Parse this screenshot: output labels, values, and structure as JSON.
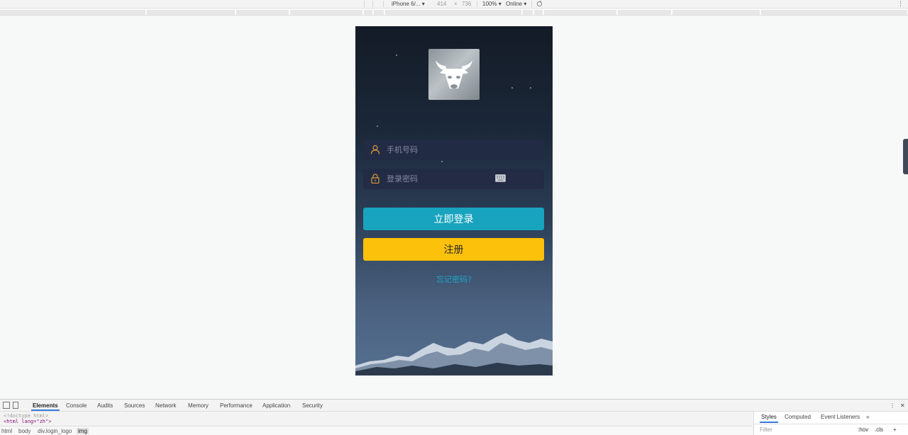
{
  "device_toolbar": {
    "device": "iPhone 6/...",
    "device_caret": "▾",
    "width": "414",
    "times": "×",
    "height": "736",
    "zoom": "100%",
    "zoom_caret": "▾",
    "network": "Online",
    "network_caret": "▾",
    "more": "⋮"
  },
  "login": {
    "phone_placeholder": "手机号码",
    "password_placeholder": "登录密码",
    "login_button": "立即登录",
    "register_button": "注册",
    "forgot_link": "忘记密码?"
  },
  "devtools": {
    "tabs": [
      "Elements",
      "Console",
      "Audits",
      "Sources",
      "Network",
      "Memory",
      "Performance",
      "Application",
      "Security"
    ],
    "code_line1": "<!doctype html>",
    "code_line2": "<html lang=\"zh\">",
    "breadcrumbs": [
      "html",
      "body",
      "div.login_logo",
      "img"
    ],
    "side_tabs": [
      "Styles",
      "Computed",
      "Event Listeners"
    ],
    "side_more": "»",
    "filter_placeholder": "Filter",
    "hov": ":hov",
    "cls": ".cls",
    "plus": "+",
    "menu": "⋮",
    "close": "✕"
  },
  "colors": {
    "login_button": "#18a3be",
    "register_button": "#fcc10b",
    "forgot_link": "#1aa8c9",
    "field_icon": "#e3a23a"
  },
  "icons": [
    "user-icon",
    "lock-icon",
    "keyboard-icon",
    "bull-logo-icon",
    "inspect-icon",
    "device-toggle-icon",
    "rotate-icon"
  ]
}
